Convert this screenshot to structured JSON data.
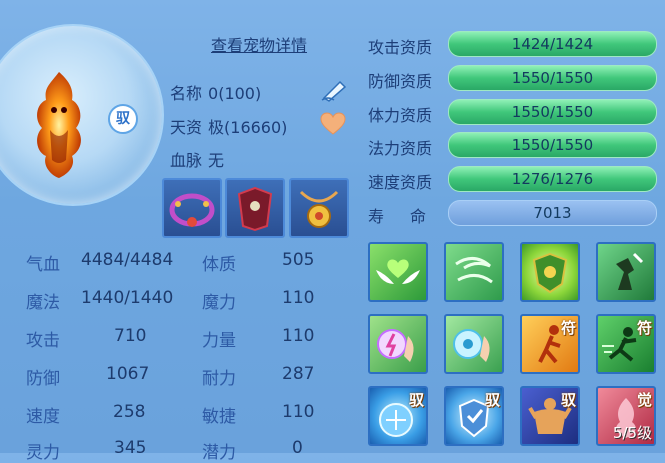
{
  "header": {
    "detail_link": "查看宠物详情",
    "portrait_badge": "驭"
  },
  "info": {
    "name_label": "名称",
    "name_value": "0(100)",
    "aptitude_label": "天资",
    "aptitude_value": "极(16660)",
    "bloodline_label": "血脉",
    "bloodline_value": "无"
  },
  "stats": [
    {
      "label": "气血",
      "value": "4484/4484"
    },
    {
      "label": "体质",
      "value": "505"
    },
    {
      "label": "魔法",
      "value": "1440/1440"
    },
    {
      "label": "魔力",
      "value": "110"
    },
    {
      "label": "攻击",
      "value": "710"
    },
    {
      "label": "力量",
      "value": "110"
    },
    {
      "label": "防御",
      "value": "1067"
    },
    {
      "label": "耐力",
      "value": "287"
    },
    {
      "label": "速度",
      "value": "258"
    },
    {
      "label": "敏捷",
      "value": "110"
    },
    {
      "label": "灵力",
      "value": "345"
    },
    {
      "label": "潜力",
      "value": "0"
    }
  ],
  "aptitudes": [
    {
      "label": "攻击资质",
      "value": "1424/1424"
    },
    {
      "label": "防御资质",
      "value": "1550/1550"
    },
    {
      "label": "体力资质",
      "value": "1550/1550"
    },
    {
      "label": "法力资质",
      "value": "1550/1550"
    },
    {
      "label": "速度资质",
      "value": "1276/1276"
    }
  ],
  "life": {
    "label_a": "寿",
    "label_b": "命",
    "value": "7013"
  },
  "skills": [
    {
      "tag": "",
      "level": ""
    },
    {
      "tag": "",
      "level": ""
    },
    {
      "tag": "",
      "level": ""
    },
    {
      "tag": "",
      "level": ""
    },
    {
      "tag": "",
      "level": ""
    },
    {
      "tag": "",
      "level": ""
    },
    {
      "tag": "符",
      "level": ""
    },
    {
      "tag": "符",
      "level": ""
    },
    {
      "tag": "驭",
      "level": ""
    },
    {
      "tag": "驭",
      "level": ""
    },
    {
      "tag": "驭",
      "level": ""
    },
    {
      "tag": "觉",
      "level": "5/5级"
    }
  ]
}
